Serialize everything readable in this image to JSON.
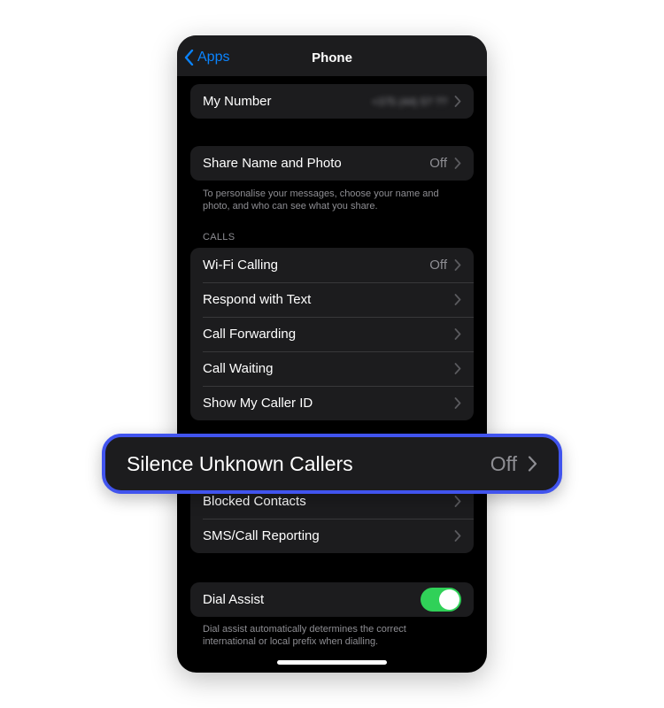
{
  "nav": {
    "back_label": "Apps",
    "title": "Phone"
  },
  "my_number": {
    "label": "My Number",
    "value": "+375 (44) 5? ??"
  },
  "share_name_photo": {
    "label": "Share Name and Photo",
    "value": "Off",
    "footnote": "To personalise your messages, choose your name and photo, and who can see what you share."
  },
  "calls": {
    "header": "CALLS",
    "items": [
      {
        "label": "Wi-Fi Calling",
        "value": "Off"
      },
      {
        "label": "Respond with Text",
        "value": ""
      },
      {
        "label": "Call Forwarding",
        "value": ""
      },
      {
        "label": "Call Waiting",
        "value": ""
      },
      {
        "label": "Show My Caller ID",
        "value": ""
      }
    ]
  },
  "callout": {
    "label": "Silence Unknown Callers",
    "value": "Off"
  },
  "blocking": {
    "items": [
      {
        "label": "Blocked Contacts"
      },
      {
        "label": "SMS/Call Reporting"
      }
    ]
  },
  "dial_assist": {
    "label": "Dial Assist",
    "enabled": true,
    "footnote": "Dial assist automatically determines the correct international or local prefix when dialling."
  },
  "colors": {
    "accent": "#0a84ff",
    "toggle_on": "#30d158",
    "callout_border": "#4154ee",
    "cell_background": "#1c1c1e",
    "secondary_text": "#8e8e93"
  },
  "icons": {
    "back": "chevron-left-icon",
    "disclosure": "chevron-right-icon"
  }
}
